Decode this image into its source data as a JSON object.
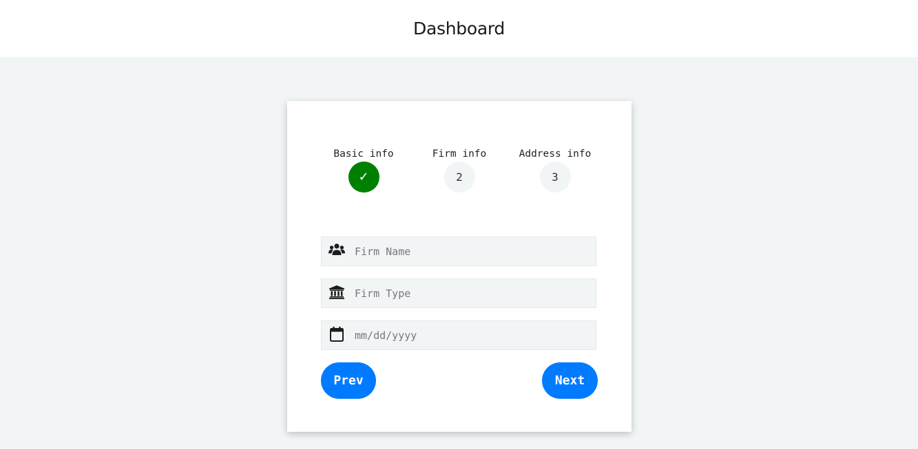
{
  "header": {
    "title": "Dashboard"
  },
  "steps": [
    {
      "label": "Basic info",
      "marker": "✓",
      "status": "complete",
      "color": "#008000"
    },
    {
      "label": "Firm info",
      "marker": "2",
      "status": "pending"
    },
    {
      "label": "Address info",
      "marker": "3",
      "status": "pending"
    }
  ],
  "form": {
    "firm_name": {
      "placeholder": "Firm Name",
      "value": "",
      "icon": "users-icon"
    },
    "firm_type": {
      "placeholder": "Firm Type",
      "value": "",
      "icon": "bank-icon"
    },
    "date": {
      "placeholder": "mm/dd/yyyy",
      "value": "",
      "icon": "calendar-icon"
    }
  },
  "buttons": {
    "prev_label": "Prev",
    "next_label": "Next",
    "color": "#007bff"
  }
}
